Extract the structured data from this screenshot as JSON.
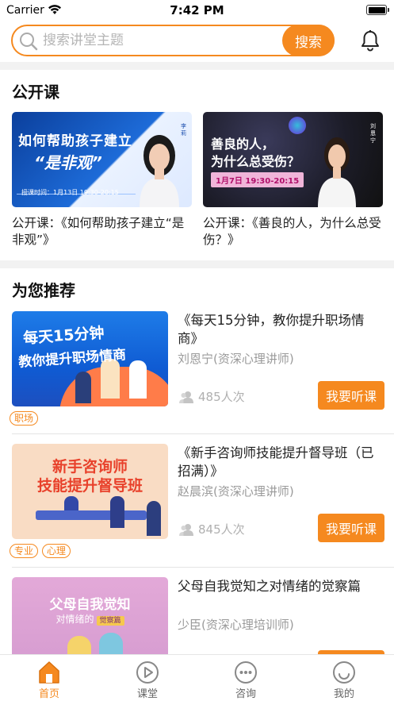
{
  "status_bar": {
    "carrier": "Carrier",
    "time": "7:42 PM"
  },
  "search": {
    "placeholder": "搜索讲堂主题",
    "button_label": "搜索"
  },
  "open_courses": {
    "title": "公开课",
    "items": [
      {
        "caption": "公开课：《如何帮助孩子建立“是非观”》",
        "thumb_title": "如何帮助孩子建立",
        "thumb_big": "“是非观”",
        "thumb_time": "授课时间：1月13日 19:30-20:15",
        "thumb_name": "李莉"
      },
      {
        "caption": "公开课：《善良的人，为什么总受伤？》",
        "thumb_title_1": "善良的人，",
        "thumb_title_2": "为什么总受伤？",
        "thumb_time": "1月7日  19:30-20:15",
        "thumb_name": "刘恩宁"
      }
    ]
  },
  "recommend": {
    "title": "为您推荐",
    "items": [
      {
        "title": "《每天15分钟，教你提升职场情商》",
        "teacher": "刘恩宁(资深心理讲师)",
        "count": "485人次",
        "button": "我要听课",
        "tags": [
          "职场"
        ],
        "thumb_line_1": "每天15分钟",
        "thumb_line_2": "教你提升职场情商"
      },
      {
        "title": "《新手咨询师技能提升督导班（已招满）》",
        "teacher": "赵晨滨(资深心理讲师)",
        "count": "845人次",
        "button": "我要听课",
        "tags": [
          "专业",
          "心理"
        ],
        "thumb_line_1": "新手咨询师",
        "thumb_line_2": "技能提升督导班"
      },
      {
        "title": "父母自我觉知之对情绪的觉察篇",
        "teacher": "少臣(资深心理培训师)",
        "count": "",
        "button": "",
        "tags": [],
        "thumb_line_1": "父母自我觉知",
        "thumb_line_2": "对情绪的",
        "thumb_pill": "觉察篇"
      }
    ]
  },
  "tabbar": {
    "items": [
      {
        "label": "首页",
        "icon": "home-icon",
        "active": true
      },
      {
        "label": "课堂",
        "icon": "play-icon",
        "active": false
      },
      {
        "label": "咨询",
        "icon": "chat-icon",
        "active": false
      },
      {
        "label": "我的",
        "icon": "smile-icon",
        "active": false
      }
    ]
  },
  "colors": {
    "accent": "#f5891f",
    "text": "#222222",
    "muted": "#9a9a9a"
  }
}
